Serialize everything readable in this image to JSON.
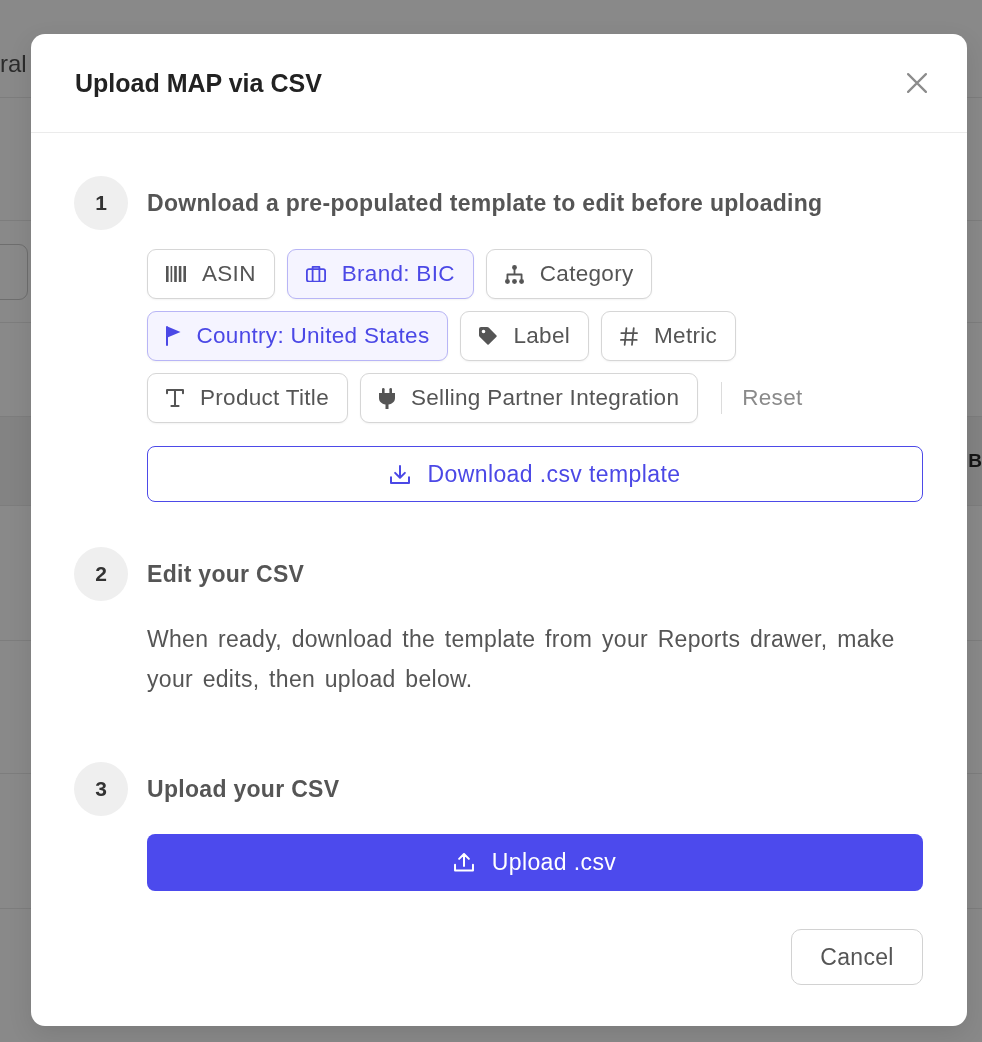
{
  "background": {
    "header_text": "ral",
    "cell_text": "B"
  },
  "dialog": {
    "title": "Upload MAP via CSV",
    "steps": [
      {
        "number": "1",
        "title": "Download a pre-populated template to edit before uploading",
        "chips": [
          {
            "kind": "asin",
            "label": "ASIN",
            "selected": false
          },
          {
            "kind": "brand",
            "label": "Brand: BIC",
            "selected": true
          },
          {
            "kind": "category",
            "label": "Category",
            "selected": false
          },
          {
            "kind": "country",
            "label": "Country: United States",
            "selected": true
          },
          {
            "kind": "label",
            "label": "Label",
            "selected": false
          },
          {
            "kind": "metric",
            "label": "Metric",
            "selected": false
          },
          {
            "kind": "title",
            "label": "Product Title",
            "selected": false
          },
          {
            "kind": "integration",
            "label": "Selling Partner Integration",
            "selected": false
          }
        ],
        "reset": "Reset",
        "button": {
          "kind": "download",
          "label": "Download .csv template"
        }
      },
      {
        "number": "2",
        "title": "Edit your CSV",
        "description": "When ready, download the template from your Reports drawer, make your edits, then upload below."
      },
      {
        "number": "3",
        "title": "Upload your CSV",
        "button": {
          "kind": "upload",
          "label": "Upload .csv"
        }
      }
    ],
    "cancel": "Cancel"
  }
}
